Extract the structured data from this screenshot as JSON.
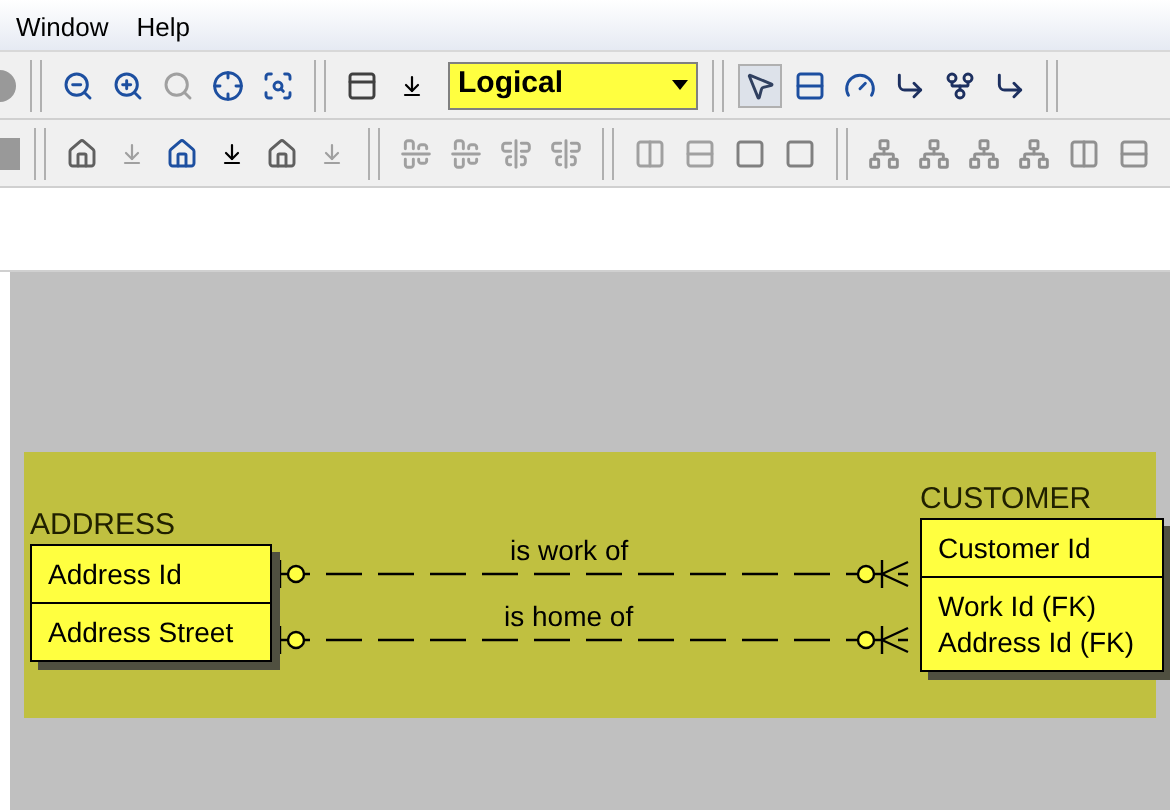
{
  "menu": [
    {
      "label": "Window"
    },
    {
      "label": "Help"
    }
  ],
  "toolbar": {
    "view_mode": "Logical"
  },
  "diagram": {
    "entities": [
      {
        "name": "ADDRESS",
        "key_attributes": [
          "Address Id"
        ],
        "attributes": [
          "Address Street"
        ]
      },
      {
        "name": "CUSTOMER",
        "key_attributes": [
          "Customer Id"
        ],
        "attributes": [
          "Work Id (FK)",
          "Address Id (FK)"
        ]
      }
    ],
    "relationships": [
      {
        "label": "is work of"
      },
      {
        "label": "is home of"
      }
    ]
  }
}
